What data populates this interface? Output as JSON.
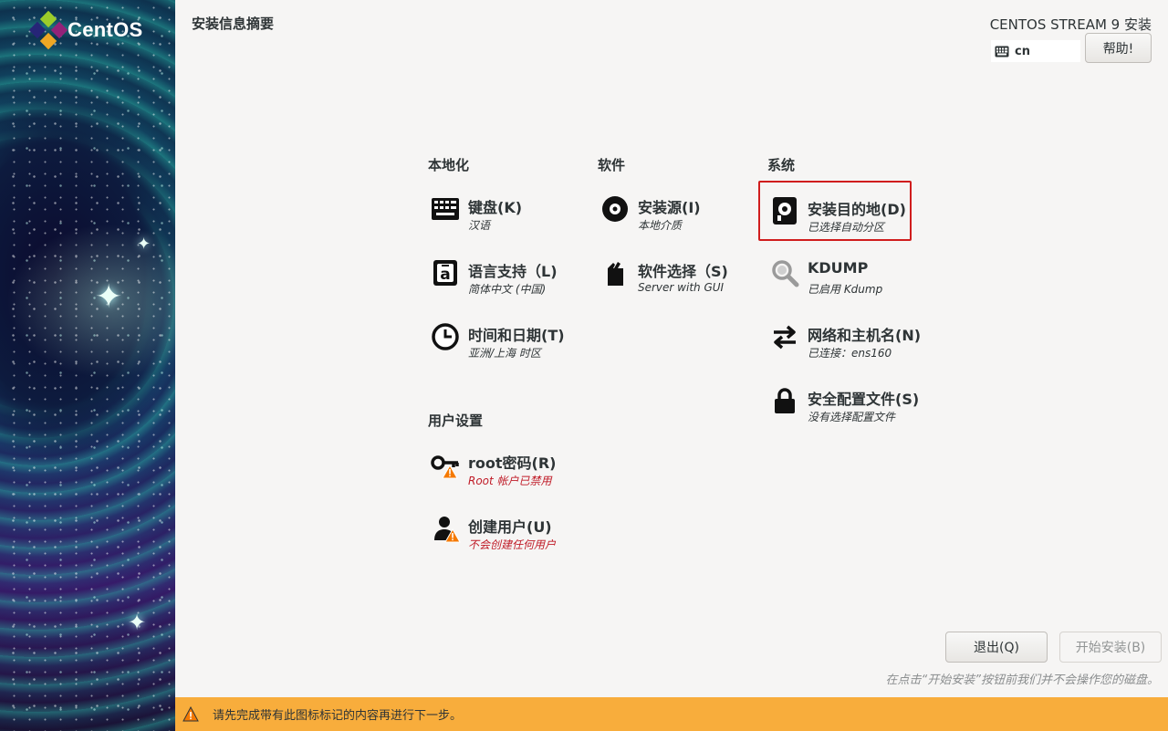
{
  "sidebar": {
    "logo_text": "CentOS"
  },
  "header": {
    "title": "安装信息摘要",
    "product": "CENTOS STREAM 9 安装",
    "keyboard_layout": "cn",
    "help_label": "帮助!"
  },
  "categories": {
    "localization": {
      "title": "本地化",
      "spokes": [
        {
          "title": "键盘(K)",
          "status": "汉语",
          "icon": "keyboard-icon"
        },
        {
          "title": "语言支持（L)",
          "status": "简体中文 (中国)",
          "icon": "language-icon"
        },
        {
          "title": "时间和日期(T)",
          "status": "亚洲/上海 时区",
          "icon": "clock-icon"
        }
      ]
    },
    "software": {
      "title": "软件",
      "spokes": [
        {
          "title": "安装源(I)",
          "status": "本地介质",
          "icon": "disc-icon"
        },
        {
          "title": "软件选择（S)",
          "status": "Server with GUI",
          "icon": "package-icon"
        }
      ]
    },
    "system": {
      "title": "系统",
      "spokes": [
        {
          "title": "安装目的地(D)",
          "status": "已选择自动分区",
          "icon": "hard-disk-icon",
          "selected": true
        },
        {
          "title": "KDUMP",
          "status": "已启用 Kdump",
          "icon": "magnifier-icon"
        },
        {
          "title": "网络和主机名(N)",
          "status": "已连接：ens160",
          "icon": "network-arrows-icon"
        },
        {
          "title": "安全配置文件(S)",
          "status": "没有选择配置文件",
          "icon": "lock-icon"
        }
      ]
    },
    "user": {
      "title": "用户设置",
      "spokes": [
        {
          "title": "root密码(R)",
          "status": "Root 帐户已禁用",
          "icon": "key-warning-icon",
          "warning": true
        },
        {
          "title": "创建用户(U)",
          "status": "不会创建任何用户",
          "icon": "user-warning-icon",
          "warning": true
        }
      ]
    }
  },
  "footer": {
    "quit_label": "退出(Q)",
    "begin_label": "开始安装(B)",
    "note": "在点击“开始安装”按钮前我们并不会操作您的磁盘。",
    "warning_message": "请先完成带有此图标标记的内容再进行下一步。"
  },
  "colors": {
    "selection_border": "#d01d1d",
    "warning_text": "#c01c28",
    "warning_bar": "#f8ad3c",
    "warning_icon": "#f57900"
  }
}
